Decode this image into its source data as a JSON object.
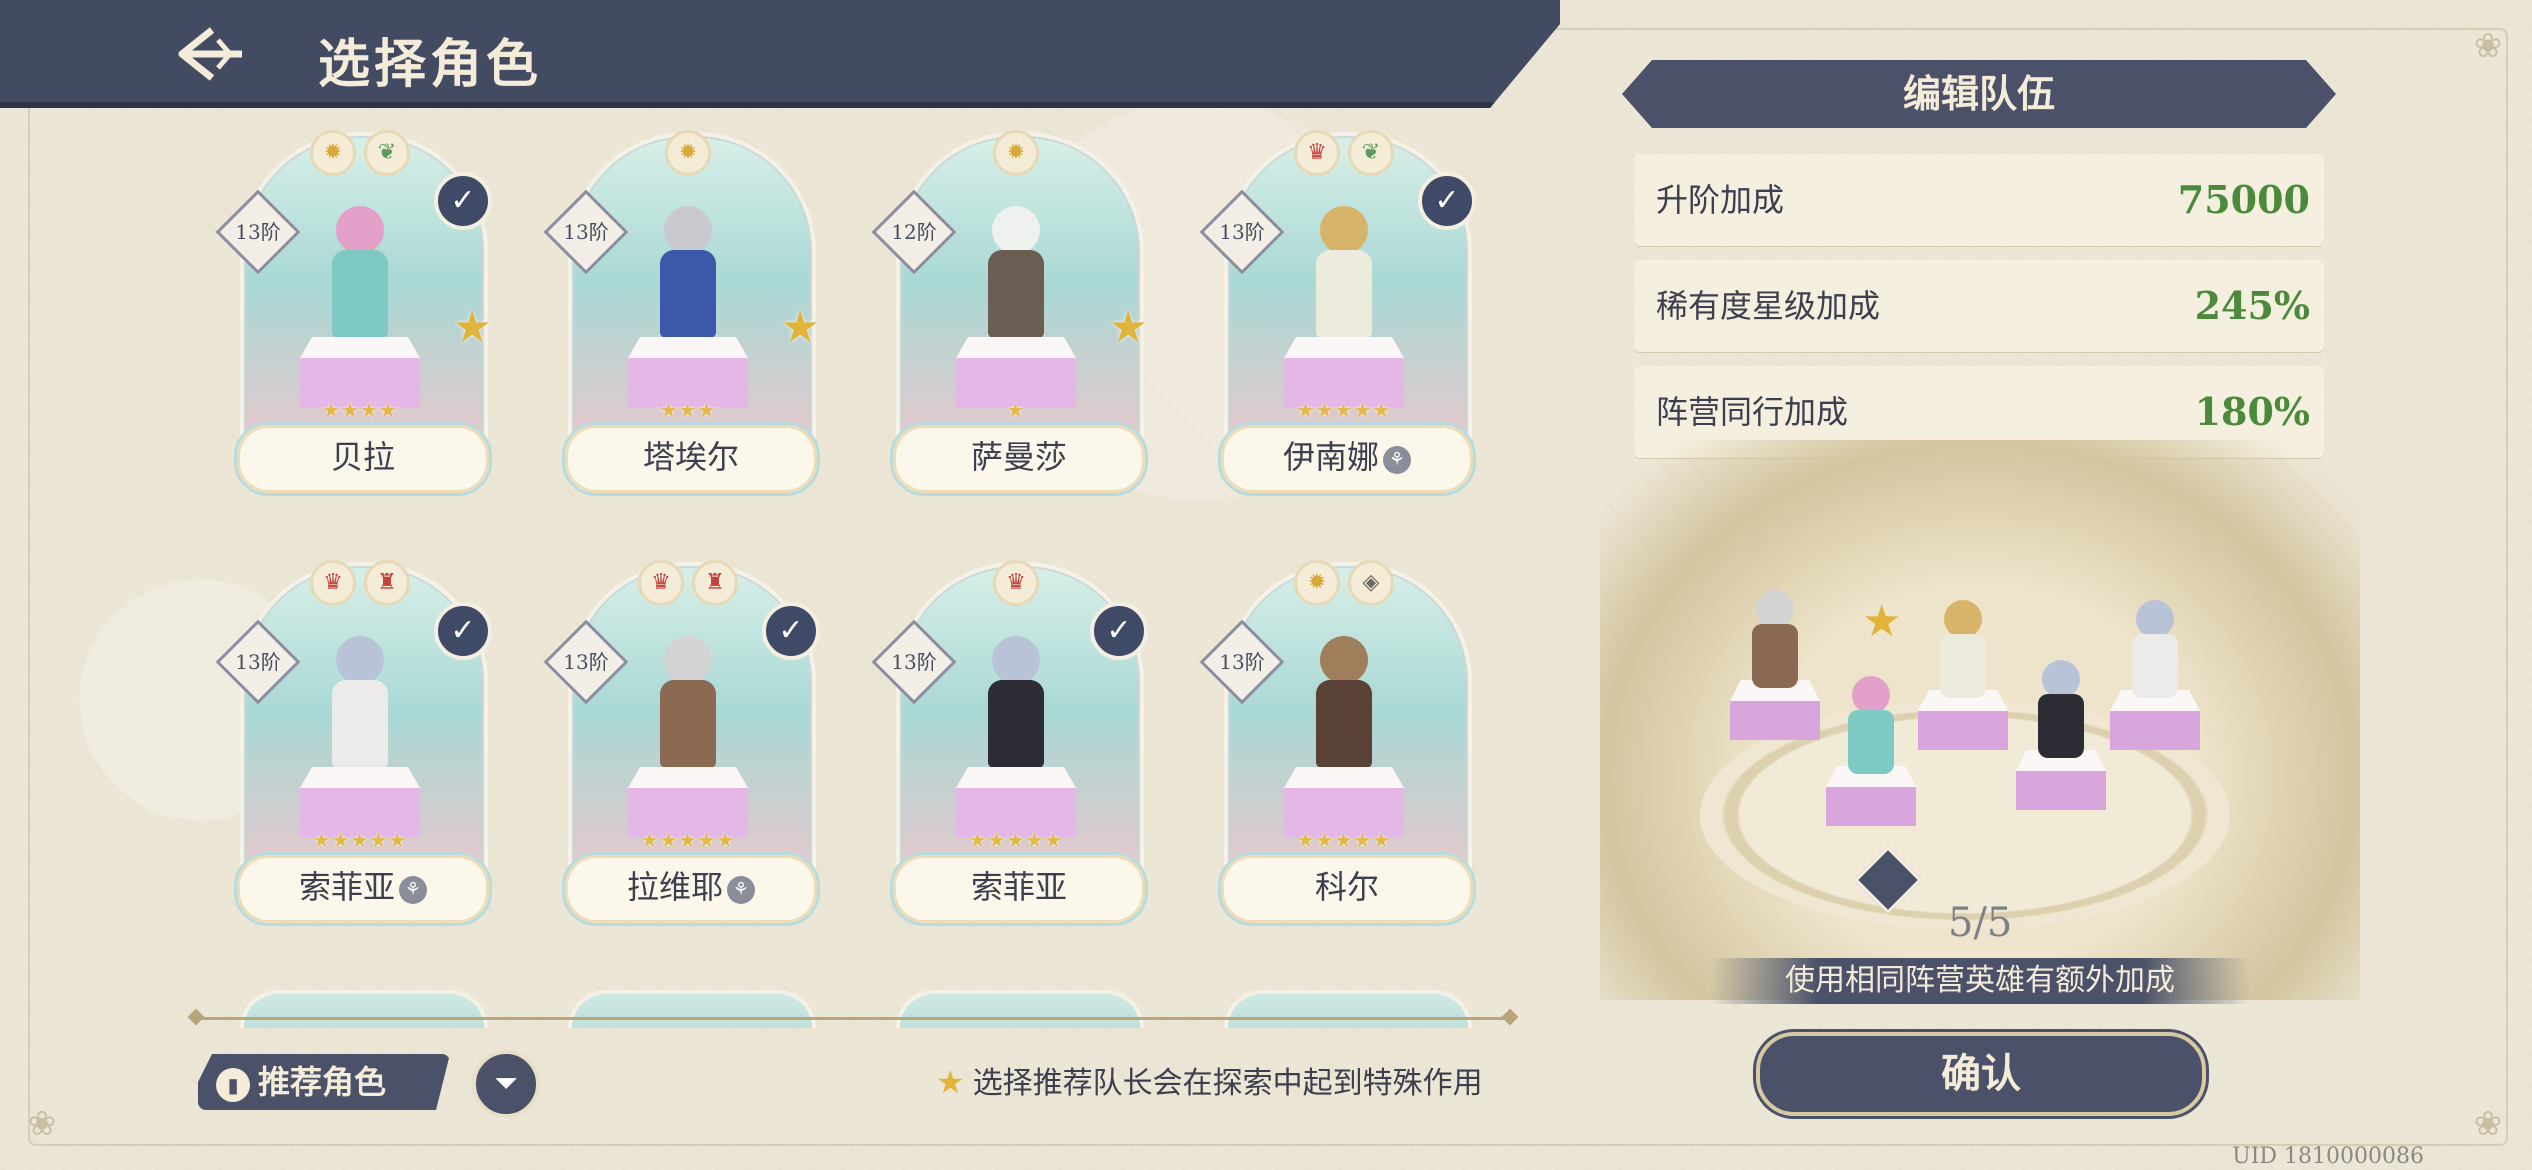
{
  "header": {
    "title": "选择角色"
  },
  "characters": [
    {
      "name": "贝拉",
      "rank": "13阶",
      "selected": true,
      "leader": true,
      "badges": [
        "sun",
        "leaf"
      ],
      "faction_tag": false
    },
    {
      "name": "塔埃尔",
      "rank": "13阶",
      "selected": false,
      "leader": true,
      "badges": [
        "sun"
      ],
      "faction_tag": false
    },
    {
      "name": "萨曼莎",
      "rank": "12阶",
      "selected": false,
      "leader": true,
      "badges": [
        "sun"
      ],
      "faction_tag": false
    },
    {
      "name": "伊南娜",
      "rank": "13阶",
      "selected": true,
      "leader": false,
      "badges": [
        "crown",
        "leaf"
      ],
      "faction_tag": true
    },
    {
      "name": "索菲亚",
      "rank": "13阶",
      "selected": true,
      "leader": false,
      "badges": [
        "crown",
        "tower"
      ],
      "faction_tag": true
    },
    {
      "name": "拉维耶",
      "rank": "13阶",
      "selected": true,
      "leader": false,
      "badges": [
        "crown",
        "tower"
      ],
      "faction_tag": true
    },
    {
      "name": "索菲亚",
      "rank": "13阶",
      "selected": true,
      "leader": false,
      "badges": [
        "crown"
      ],
      "faction_tag": false
    },
    {
      "name": "科尔",
      "rank": "13阶",
      "selected": false,
      "leader": false,
      "badges": [
        "sun",
        "diamond"
      ],
      "faction_tag": false
    }
  ],
  "bottom": {
    "recommend_label": "推荐角色",
    "hint": "选择推荐队长会在探索中起到特殊作用"
  },
  "team_panel": {
    "title": "编辑队伍",
    "bonuses": [
      {
        "label": "升阶加成",
        "value": "75000"
      },
      {
        "label": "稀有度星级加成",
        "value": "245%"
      },
      {
        "label": "阵营同行加成",
        "value": "180%"
      }
    ],
    "count": "5/5",
    "tip": "使用相同阵营英雄有额外加成",
    "confirm_label": "确认"
  },
  "uid": "UID 1810000086",
  "colors": {
    "header": "#434b63",
    "accent_green": "#4b8a3a",
    "gold": "#e0b43a"
  }
}
